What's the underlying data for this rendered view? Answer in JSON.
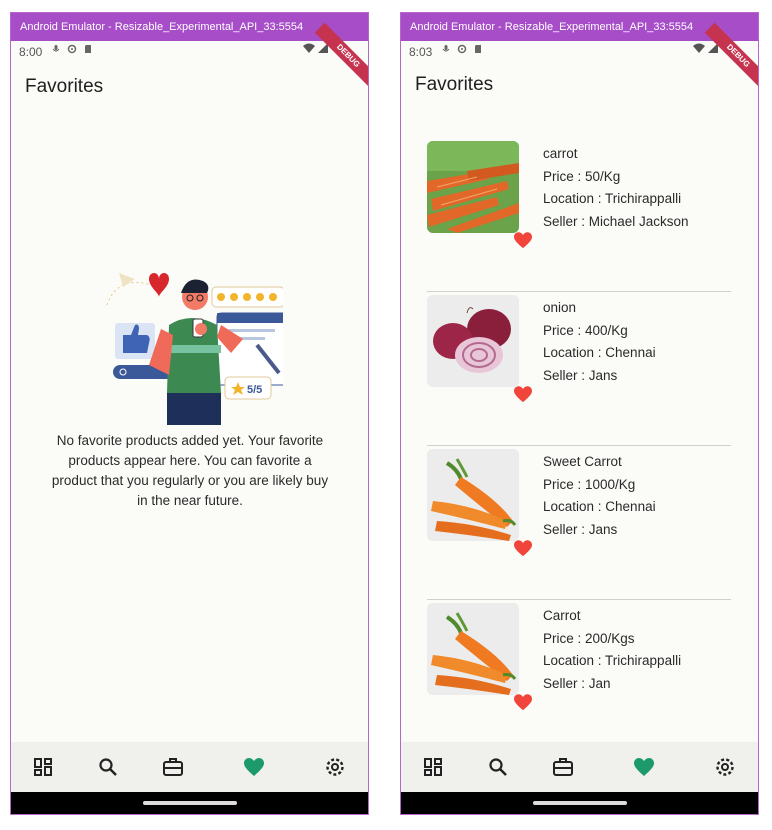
{
  "window_title": "Android Emulator - Resizable_Experimental_API_33:5554",
  "debug_label": "DEBUG",
  "screen_left": {
    "time": "8:00",
    "title": "Favorites",
    "empty_message": "No favorite products added yet. Your favorite products appear here. You can favorite a product that you regularly or you are likely buy in the near future.",
    "illustration_rating": "5/5"
  },
  "screen_right": {
    "time": "8:03",
    "title": "Favorites",
    "items": [
      {
        "name": "carrot",
        "price": "Price : 50/Kg",
        "location": "Location : Trichirappalli",
        "seller": "Seller : Michael Jackson"
      },
      {
        "name": "onion",
        "price": "Price : 400/Kg",
        "location": "Location : Chennai",
        "seller": "Seller : Jans"
      },
      {
        "name": "Sweet Carrot",
        "price": "Price : 1000/Kg",
        "location": "Location : Chennai",
        "seller": "Seller : Jans"
      },
      {
        "name": "Carrot",
        "price": "Price : 200/Kgs",
        "location": "Location : Trichirappalli",
        "seller": "Seller : Jan"
      }
    ]
  },
  "nav_icons": [
    "dashboard-icon",
    "search-icon",
    "briefcase-icon",
    "heart-icon",
    "gear-icon"
  ],
  "colors": {
    "titlebar": "#a64dc7",
    "accent": "#1c9a6c",
    "heart": "#f1443a",
    "ribbon": "#c5334f"
  }
}
